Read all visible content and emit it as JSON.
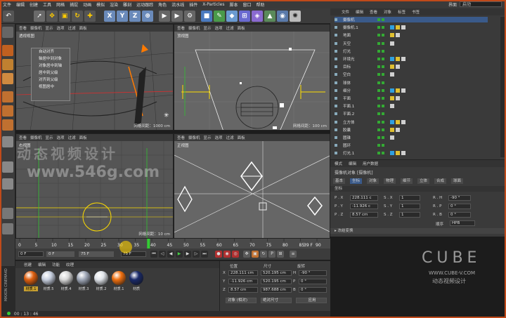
{
  "menu": [
    "文件",
    "编辑",
    "创建",
    "工具",
    "网格",
    "捕捉",
    "动画",
    "模拟",
    "渲染",
    "雕刻",
    "运动跟踪",
    "角色",
    "流水线",
    "插件",
    "X-Particles",
    "脚本",
    "窗口",
    "帮助"
  ],
  "layout": {
    "label": "界面",
    "value": "启动"
  },
  "viewport_menu": [
    "查看",
    "摄像机",
    "显示",
    "选项",
    "过滤",
    "面板"
  ],
  "viewports": [
    {
      "name": "透视视图",
      "info": "网格间距：1000 cm"
    },
    {
      "name": "顶视图",
      "info": "网格间距：100 cm"
    },
    {
      "name": "右视图",
      "info": "网格间距：10 cm"
    },
    {
      "name": "正视图",
      "info": ""
    }
  ],
  "popup_menu": [
    "自动对齐",
    "轴居中到对象",
    "对象居中到轴",
    "居中到父级",
    "对齐到父级",
    "视图居中"
  ],
  "watermark": {
    "line1": "动态视频设计",
    "line2": "www.546g.com"
  },
  "object_manager": {
    "tabs": [
      "文件",
      "编辑",
      "查看",
      "对象",
      "标签",
      "书签"
    ],
    "rows": [
      "摄像机",
      "摄像机.1",
      "地面",
      "天空",
      "灯光",
      "环境光",
      "目标",
      "空白",
      "球体",
      "细分",
      "平面",
      "平面.1",
      "平面.2",
      "立方体",
      "胶囊",
      "圆锥",
      "圆环",
      "灯光.1"
    ]
  },
  "attributes": {
    "tabs": [
      "模式",
      "编辑",
      "用户数据"
    ],
    "title": "摄像机对象 [摄像机]",
    "subtabs": [
      "基本",
      "坐标",
      "对象",
      "物理",
      "细节",
      "立体",
      "合成",
      "球面"
    ],
    "section": "坐标",
    "rows": [
      {
        "p": "P . X",
        "pv": "228.111 c",
        "s": "S . X",
        "sv": "1",
        "r": "R . H",
        "rv": "-90 °"
      },
      {
        "p": "P . Y",
        "pv": "-11.926 c",
        "s": "S . Y",
        "sv": "1",
        "r": "R . P",
        "rv": "0 °"
      },
      {
        "p": "P . Z",
        "pv": "8.57 cm",
        "s": "S . Z",
        "sv": "1",
        "r": "R . B",
        "rv": "0 °"
      }
    ],
    "order_label": "顺序",
    "order_value": "HPB",
    "freeze": "▸ 冻结变换"
  },
  "timeline": {
    "ticks": [
      "0",
      "5",
      "10",
      "15",
      "20",
      "25",
      "30",
      "35",
      "40",
      "45",
      "50",
      "55",
      "60",
      "65",
      "70",
      "75",
      "80",
      "85",
      "90"
    ],
    "current": "39 F"
  },
  "transport": {
    "start": "0 F",
    "mid": "0 F",
    "end": "75 F",
    "max": "75 F"
  },
  "materials": {
    "tabs": [
      "创建",
      "编辑",
      "功能",
      "纹理"
    ],
    "items": [
      {
        "label": "材质.1",
        "color": "#e06010"
      },
      {
        "label": "材质.5",
        "color": "#c8d0e0"
      },
      {
        "label": "材质.4",
        "color": "#d8d8d8"
      },
      {
        "label": "材质.3",
        "color": "#a0a8b8"
      },
      {
        "label": "材质.2",
        "color": "#e0e4ea"
      },
      {
        "label": "材质.1",
        "color": "#f07010"
      },
      {
        "label": "材质",
        "color": "#1a2a6a"
      }
    ]
  },
  "coordinates": {
    "headers": [
      "位置",
      "尺寸",
      "旋转"
    ],
    "rows": [
      {
        "axis": "X",
        "pos": "228.111 cm",
        "size": "520.195 cm",
        "rot_l": "H",
        "rot": "-90 °"
      },
      {
        "axis": "Y",
        "pos": "-11.926 cm",
        "size": "520.195 cm",
        "rot_l": "P",
        "rot": "0 °"
      },
      {
        "axis": "Z",
        "pos": "8.57 cm",
        "size": "987.688 cm",
        "rot_l": "B",
        "rot": "0 °"
      }
    ],
    "mode": "对象 (相对)",
    "size_mode": "绝对尺寸",
    "apply": "应用"
  },
  "status": {
    "time": "00 : 13 : 46"
  },
  "brand": {
    "logo": "CUBE",
    "url": "WWW.CUBE-V.COM",
    "sub": "动态视频设计",
    "maxon": "MAXON CINEMA4D"
  },
  "colors": {
    "accent": "#c04a1a",
    "selected": "#3a5a8a"
  }
}
